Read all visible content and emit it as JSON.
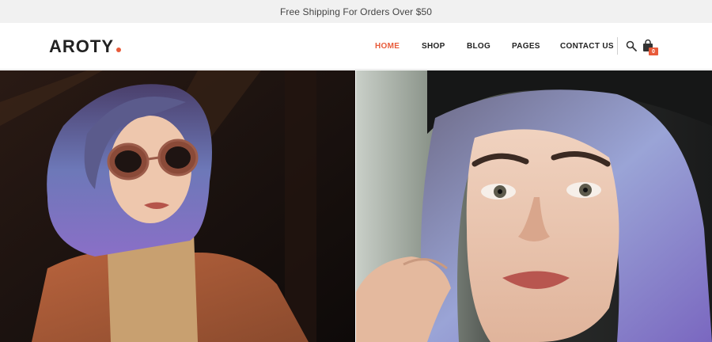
{
  "topbar": {
    "text": "Free Shipping For Orders Over $50"
  },
  "brand": {
    "name": "AROTY",
    "accent": "#e85b3a"
  },
  "nav": {
    "items": [
      {
        "label": "HOME",
        "active": true
      },
      {
        "label": "SHOP",
        "active": false
      },
      {
        "label": "BLOG",
        "active": false
      },
      {
        "label": "PAGES",
        "active": false
      },
      {
        "label": "CONTACT US",
        "active": false
      }
    ]
  },
  "header_icons": {
    "search": "search-icon",
    "cart": "shopping-bag-icon",
    "cart_count": "0"
  },
  "banners": [
    {
      "name": "banner-image-left",
      "subject": "woman-with-blue-hair-sunglasses"
    },
    {
      "name": "banner-image-right",
      "subject": "woman-with-blue-hair-closeup"
    }
  ]
}
